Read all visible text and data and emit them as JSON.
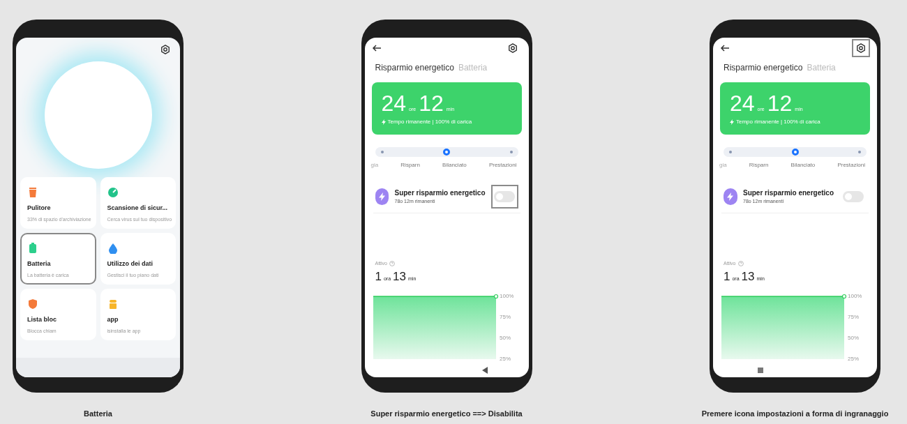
{
  "phones": [
    {
      "kind": "home",
      "caption": "Batteria",
      "gear_highlighted": false,
      "cards": [
        {
          "color": "#f47a3a",
          "title": "Pulitore",
          "subtitle": "33% di spazio d'archiviazione",
          "highlighted": false
        },
        {
          "color": "#22c38a",
          "title": "Scansione di sicur...",
          "subtitle": "Cerca virus sul tuo dispositivo",
          "highlighted": false
        },
        {
          "color": "#2ccf8c",
          "title": "Batteria",
          "subtitle": "La batteria è carica",
          "highlighted": true
        },
        {
          "color": "#2f8ff0",
          "title": "Utilizzo dei dati",
          "subtitle": "Gestisci il tuo piano dati",
          "highlighted": false
        },
        {
          "color": "#f47a3a",
          "title": "Lista bloc",
          "subtitle": "Blocca chiam",
          "highlighted": false
        },
        {
          "color": "#f7b52a",
          "title": "app",
          "subtitle": "isinstalla le app",
          "highlighted": false
        }
      ]
    },
    {
      "kind": "battery",
      "caption": "Super risparmio energetico ==> Disabilita",
      "gear_highlighted": false,
      "tabs": [
        {
          "label": "Risparmio energetico",
          "selected": true
        },
        {
          "label": "Batteria",
          "selected": false
        }
      ],
      "hours": "24",
      "hours_unit": "ore",
      "minutes": "12",
      "minutes_unit": "min",
      "status": "Tempo rimanente | 100% di carica",
      "mode": {
        "level": 0.5,
        "labels": [
          "gia",
          "Risparn",
          "Bilanciato",
          "Prestazioni"
        ]
      },
      "saver": {
        "title": "Super risparmio energetico",
        "subtitle": "78o 12m rimanenti",
        "on": false,
        "highlighted": true
      },
      "active_label": "Attivo",
      "active_hours": "1",
      "active_hours_unit": "ora",
      "active_minutes": "13",
      "active_minutes_unit": "min",
      "chart_axis_labels": [
        "100%",
        "75%",
        "50%",
        "25%"
      ]
    },
    {
      "kind": "battery",
      "caption": "Premere icona impostazioni a forma di ingranaggio",
      "gear_highlighted": true,
      "tabs": [
        {
          "label": "Risparmio energetico",
          "selected": true
        },
        {
          "label": "Batteria",
          "selected": false
        }
      ],
      "hours": "24",
      "hours_unit": "ore",
      "minutes": "12",
      "minutes_unit": "min",
      "status": "Tempo rimanente | 100% di carica",
      "mode": {
        "level": 0.5,
        "labels": [
          "gia",
          "Risparn",
          "Bilanciato",
          "Prestazioni"
        ]
      },
      "saver": {
        "title": "Super risparmio energetico",
        "subtitle": "78o 12m rimanenti",
        "on": false,
        "highlighted": false
      },
      "active_label": "Attivo",
      "active_hours": "1",
      "active_hours_unit": "ora",
      "active_minutes": "13",
      "active_minutes_unit": "min",
      "chart_axis_labels": [
        "100%",
        "75%",
        "50%",
        "25%"
      ]
    }
  ]
}
